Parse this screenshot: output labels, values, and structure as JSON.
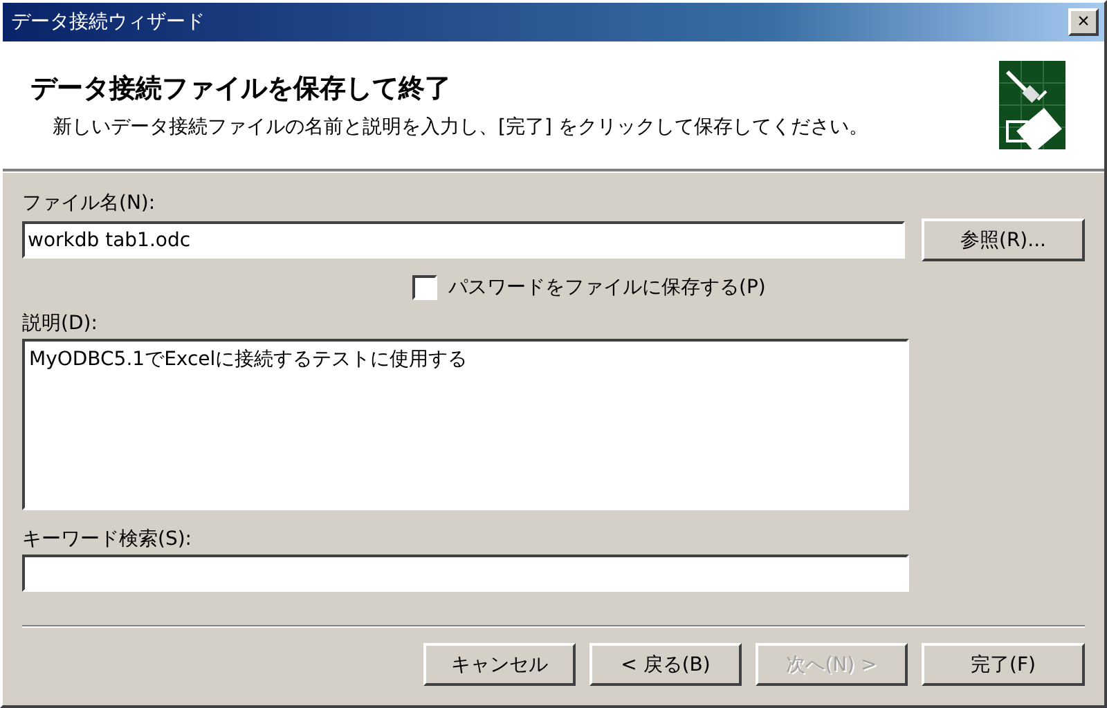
{
  "window": {
    "title": "データ接続ウィザード",
    "close": "×"
  },
  "header": {
    "title": "データ接続ファイルを保存して終了",
    "subtitle": "新しいデータ接続ファイルの名前と説明を入力し、[完了] をクリックして保存してください。"
  },
  "file_name": {
    "label": "ファイル名(N):",
    "value": "workdb tab1.odc",
    "browse": "参照(R)..."
  },
  "save_password": {
    "label": "パスワードをファイルに保存する(P)",
    "checked": false
  },
  "description": {
    "label": "説明(D):",
    "value": "MyODBC5.1でExcelに接続するテストに使用する"
  },
  "keywords": {
    "label": "キーワード検索(S):"
  },
  "buttons": [
    {
      "label": "キャンセル",
      "disabled": false
    },
    {
      "label": "< 戻る(B)",
      "disabled": false
    },
    {
      "label": "次へ(N) >",
      "disabled": true
    },
    {
      "label": "完了(F)",
      "disabled": false
    }
  ]
}
